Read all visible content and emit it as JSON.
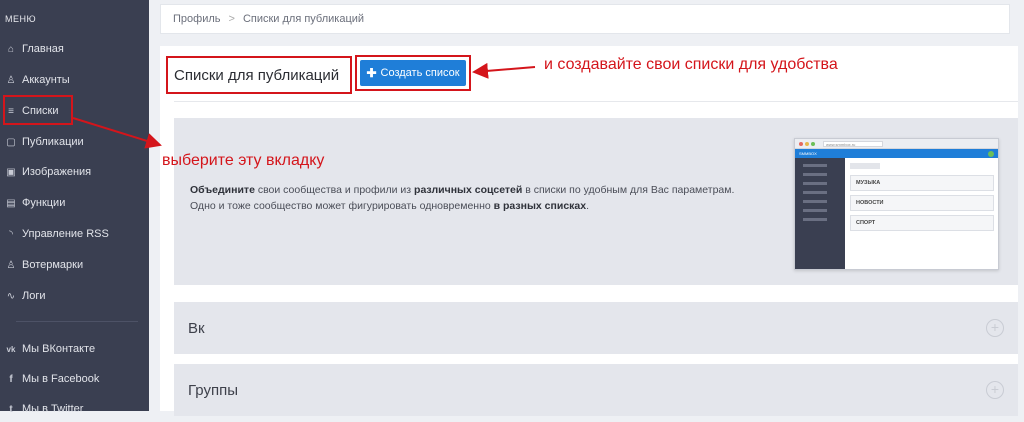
{
  "sidebar": {
    "title": "МЕНЮ",
    "items": [
      {
        "label": "Главная",
        "icon": "home-icon",
        "glyph": "⌂"
      },
      {
        "label": "Аккаунты",
        "icon": "user-icon",
        "glyph": "♙"
      },
      {
        "label": "Списки",
        "icon": "list-icon",
        "glyph": "≡"
      },
      {
        "label": "Публикации",
        "icon": "document-icon",
        "glyph": "▢"
      },
      {
        "label": "Изображения",
        "icon": "image-icon",
        "glyph": "▣"
      },
      {
        "label": "Функции",
        "icon": "box-icon",
        "glyph": "▤"
      },
      {
        "label": "Управление RSS",
        "icon": "rss-icon",
        "glyph": "◝"
      },
      {
        "label": "Вотермарки",
        "icon": "watermark-icon",
        "glyph": "♙"
      },
      {
        "label": "Логи",
        "icon": "pulse-icon",
        "glyph": "∿"
      }
    ],
    "social": [
      {
        "label": "Мы ВКонтакте",
        "icon": "vk-icon",
        "glyph": "vk"
      },
      {
        "label": "Мы в Facebook",
        "icon": "facebook-icon",
        "glyph": "f"
      },
      {
        "label": "Мы в Twitter",
        "icon": "twitter-icon",
        "glyph": "t"
      }
    ]
  },
  "breadcrumb": {
    "home": "Профиль",
    "separator": ">",
    "current": "Списки для публикаций"
  },
  "page": {
    "title": "Списки для публикаций",
    "create_button": "Создать список",
    "create_icon": "✚"
  },
  "annotations": {
    "create_hint": "и создавайте свои списки для удобства",
    "tab_hint": "выберите эту вкладку"
  },
  "info": {
    "line1_bold1": "Объедините",
    "line1_text1": " свои сообщества и профили из ",
    "line1_bold2": "различных соцсетей",
    "line1_text2": " в списки по удобным для Вас параметрам.",
    "line2_text": "Одно и тоже сообщество может фигурировать одновременно ",
    "line2_bold": "в разных списках",
    "line2_end": "."
  },
  "mock": {
    "url": "www.smmbox.ru",
    "brand": "SMMBOX",
    "rows": [
      "МУЗЫКА",
      "НОВОСТИ",
      "СПОРТ"
    ]
  },
  "groups": [
    {
      "label": "Вк"
    },
    {
      "label": "Группы"
    }
  ],
  "colors": {
    "sidebar": "#3a3f51",
    "accent": "#1f7ed8",
    "annotation": "#d4151b"
  }
}
